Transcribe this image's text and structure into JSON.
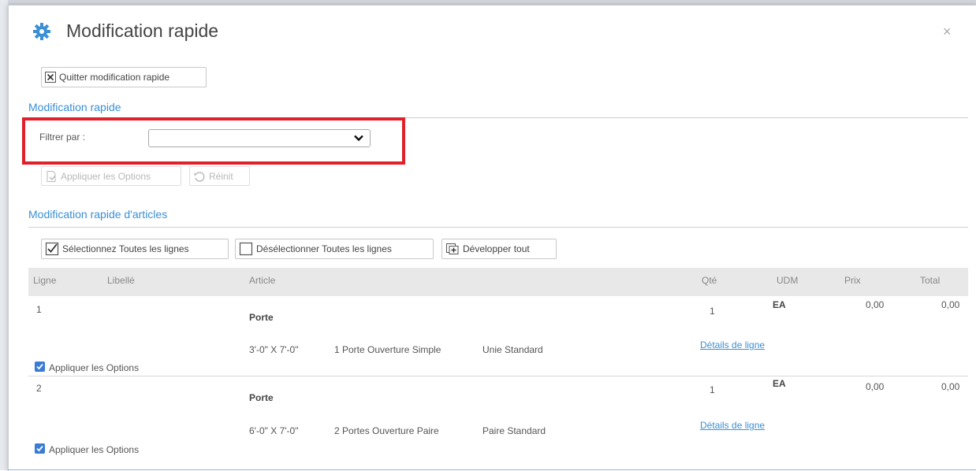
{
  "dialog": {
    "title": "Modification rapide",
    "close_glyph": "×"
  },
  "toolbar": {
    "quit_label": "Quitter modification rapide"
  },
  "section1": {
    "title": "Modification rapide",
    "filter_label": "Filtrer par :",
    "filter_value": "",
    "apply_options_label": "Appliquer les Options",
    "reset_label": "Réinit"
  },
  "section2": {
    "title": "Modification rapide d'articles",
    "select_all_label": "Sélectionnez Toutes les lignes",
    "deselect_all_label": "Désélectionner Toutes les lignes",
    "expand_all_label": "Développer tout"
  },
  "table": {
    "headers": {
      "line": "Ligne",
      "label": "Libellé",
      "article": "Article",
      "qty": "Qté",
      "uom": "UDM",
      "price": "Prix",
      "total": "Total"
    },
    "rows": [
      {
        "line": "1",
        "article": "Porte",
        "dimension": "3'-0\" X 7'-0\"",
        "config": "1 Porte Ouverture Simple",
        "style": "Unie Standard",
        "qty": "1",
        "uom": "EA",
        "price": "0,00",
        "total": "0,00",
        "details_link": "Détails de ligne",
        "apply_options": "Appliquer les Options",
        "checked": true
      },
      {
        "line": "2",
        "article": "Porte",
        "dimension": "6'-0\" X 7'-0\"",
        "config": "2 Portes Ouverture Paire",
        "style": "Paire Standard",
        "qty": "1",
        "uom": "EA",
        "price": "0,00",
        "total": "0,00",
        "details_link": "Détails de ligne",
        "apply_options": "Appliquer les Options",
        "checked": true
      }
    ]
  },
  "colors": {
    "accent": "#3a8fd6",
    "highlight": "#e0202a",
    "header_bg": "#e8e8e8",
    "checkbox": "#3a7bd5"
  },
  "icons": [
    "gear-icon",
    "close-icon",
    "close-box-icon",
    "chevron-down-icon",
    "apply-options-icon",
    "reset-icon",
    "checked-box-icon",
    "empty-box-icon",
    "expand-icon",
    "checkbox-checked-icon"
  ]
}
